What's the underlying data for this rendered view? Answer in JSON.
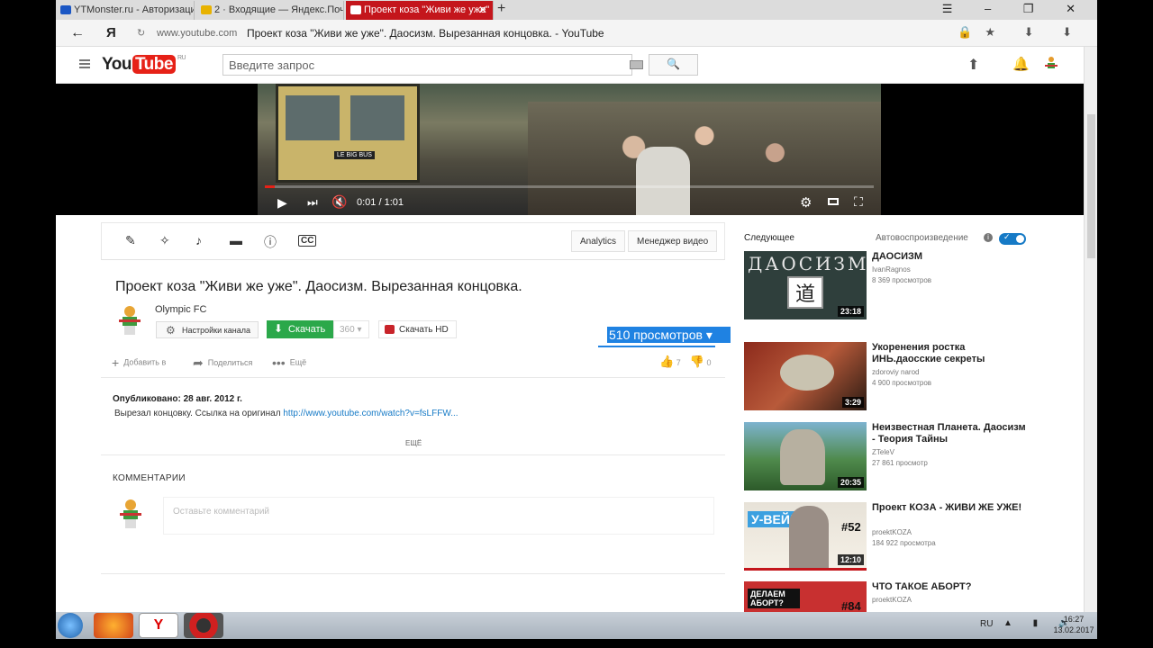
{
  "browser": {
    "tabs": [
      {
        "label": "YTMonster.ru - Авторизация",
        "color": "#1a56c4"
      },
      {
        "label": "2 · Входящие — Яндекс.Почта",
        "color": "#e8b200"
      },
      {
        "label": "Проект коза \"Живи же уже\"",
        "color": "#ffffff",
        "active": true
      }
    ],
    "new_tab": "+",
    "window_buttons": "☰ – ❐ ✕",
    "back": "←",
    "yandex_logo": "Я",
    "reload": "↻",
    "domain": "www.youtube.com",
    "page_title": "Проект коза \"Живи же уже\". Даосизм. Вырезанная концовка. - YouTube",
    "right_icons": "🔒★ ⬇ ⬇"
  },
  "youtube": {
    "logo_you": "You",
    "logo_tube": "Tube",
    "logo_region": "RU",
    "search_placeholder": "Введите запрос",
    "search_icon": "🔍",
    "upload_icon": "⬆",
    "bell_icon": "🔔"
  },
  "player": {
    "bus_sign": "LE BIG BUS",
    "progress_fraction": 0.016,
    "play_icon": "▶",
    "next_icon": "⏭",
    "mute_icon": "🔇",
    "time": "0:01 / 1:01",
    "settings_icon": "⚙",
    "fullscreen_icon": "⛶"
  },
  "toolbar": {
    "icons": [
      "✎",
      "✧",
      "♪",
      "▬",
      "ⓘ",
      "CC"
    ],
    "analytics": "Analytics",
    "video_manager": "Менеджер видео"
  },
  "video": {
    "title": "Проект коза \"Живи же уже\". Даосизм. Вырезанная концовка.",
    "channel": "Olympic FC",
    "channel_settings": "Настройки канала",
    "download": "Скачать",
    "download_count": "360 ▾",
    "download_hd": "Скачать HD",
    "views": "510 просмотров ▾",
    "add_to": "Добавить в",
    "share": "Поделиться",
    "more": "Ещё",
    "likes": "7",
    "dislikes": "0",
    "published": "Опубликовано: 28 авг. 2012 г.",
    "description": "Вырезал концовку. Ссылка на оригинал ",
    "description_link": "http://www.youtube.com/watch?v=fsLFFW...",
    "show_more": "ЕЩЁ",
    "comments_header": "КОММЕНТАРИИ",
    "comment_placeholder": "Оставьте комментарий"
  },
  "sidebar": {
    "next_label": "Следующее",
    "autoplay_label": "Автовоспроизведение",
    "autoplay_on": true,
    "items": [
      {
        "title": "ДАОСИЗМ",
        "channel": "IvanRagnos",
        "views": "8 369 просмотров",
        "duration": "23:18",
        "thumb_text": "ДАОСИЗМ"
      },
      {
        "title": "Укоренения ростка ИНЬ.даосские секреты",
        "channel": "zdoroviy narod",
        "views": "4 900 просмотров",
        "duration": "3:29"
      },
      {
        "title": "Неизвестная Планета. Даосизм - Теория Тайны",
        "channel": "ZTeleV",
        "views": "27 861 просмотр",
        "duration": "20:35"
      },
      {
        "title": "Проект КОЗА - ЖИВИ ЖЕ УЖЕ!",
        "channel": "proektKOZA",
        "views": "184 922 просмотра",
        "duration": "12:10",
        "thumb_text": "У-ВЕЙ!",
        "badge": "#52"
      },
      {
        "title": "ЧТО ТАКОЕ АБОРТ?",
        "channel": "proektKOZA",
        "views": "",
        "duration": "",
        "thumb_text": "ДЕЛАЕМ АБОРТ?",
        "badge": "#84"
      }
    ]
  },
  "taskbar": {
    "lang": "RU",
    "time": "16:27",
    "date": "13.02.2017"
  }
}
